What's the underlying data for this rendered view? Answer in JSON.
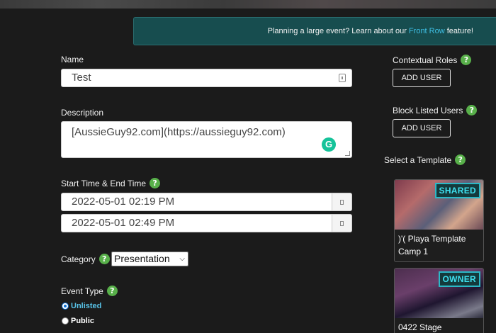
{
  "banner": {
    "prefix": "Planning a large event? Learn about our",
    "link": "Front Row",
    "suffix": "feature!"
  },
  "form": {
    "name_label": "Name",
    "name_value": "Test",
    "description_label": "Description",
    "description_value": "[AussieGuy92.com](https://aussieguy92.com)",
    "time_label": "Start Time & End Time",
    "start_time": "2022-05-01 02:19 PM",
    "end_time": "2022-05-01 02:49 PM",
    "category_label": "Category",
    "category_value": "Presentation",
    "event_type_label": "Event Type",
    "event_type_options": [
      "Unlisted",
      "Public"
    ],
    "help_glyph": "?"
  },
  "sidebar": {
    "contextual_roles_label": "Contextual Roles",
    "block_listed_label": "Block Listed Users",
    "add_user_label": "ADD USER",
    "template_label": "Select a Template",
    "templates": [
      {
        "badge": "SHARED",
        "title": ")'( Playa Template Camp 1"
      },
      {
        "badge": "OWNER",
        "title": "0422 Stage"
      }
    ]
  },
  "colors": {
    "background": "#1b1b1b",
    "banner": "#174d4f",
    "link": "#3fc0e6",
    "help_badge": "#58b04a",
    "badge_text": "#3ee0ef"
  }
}
